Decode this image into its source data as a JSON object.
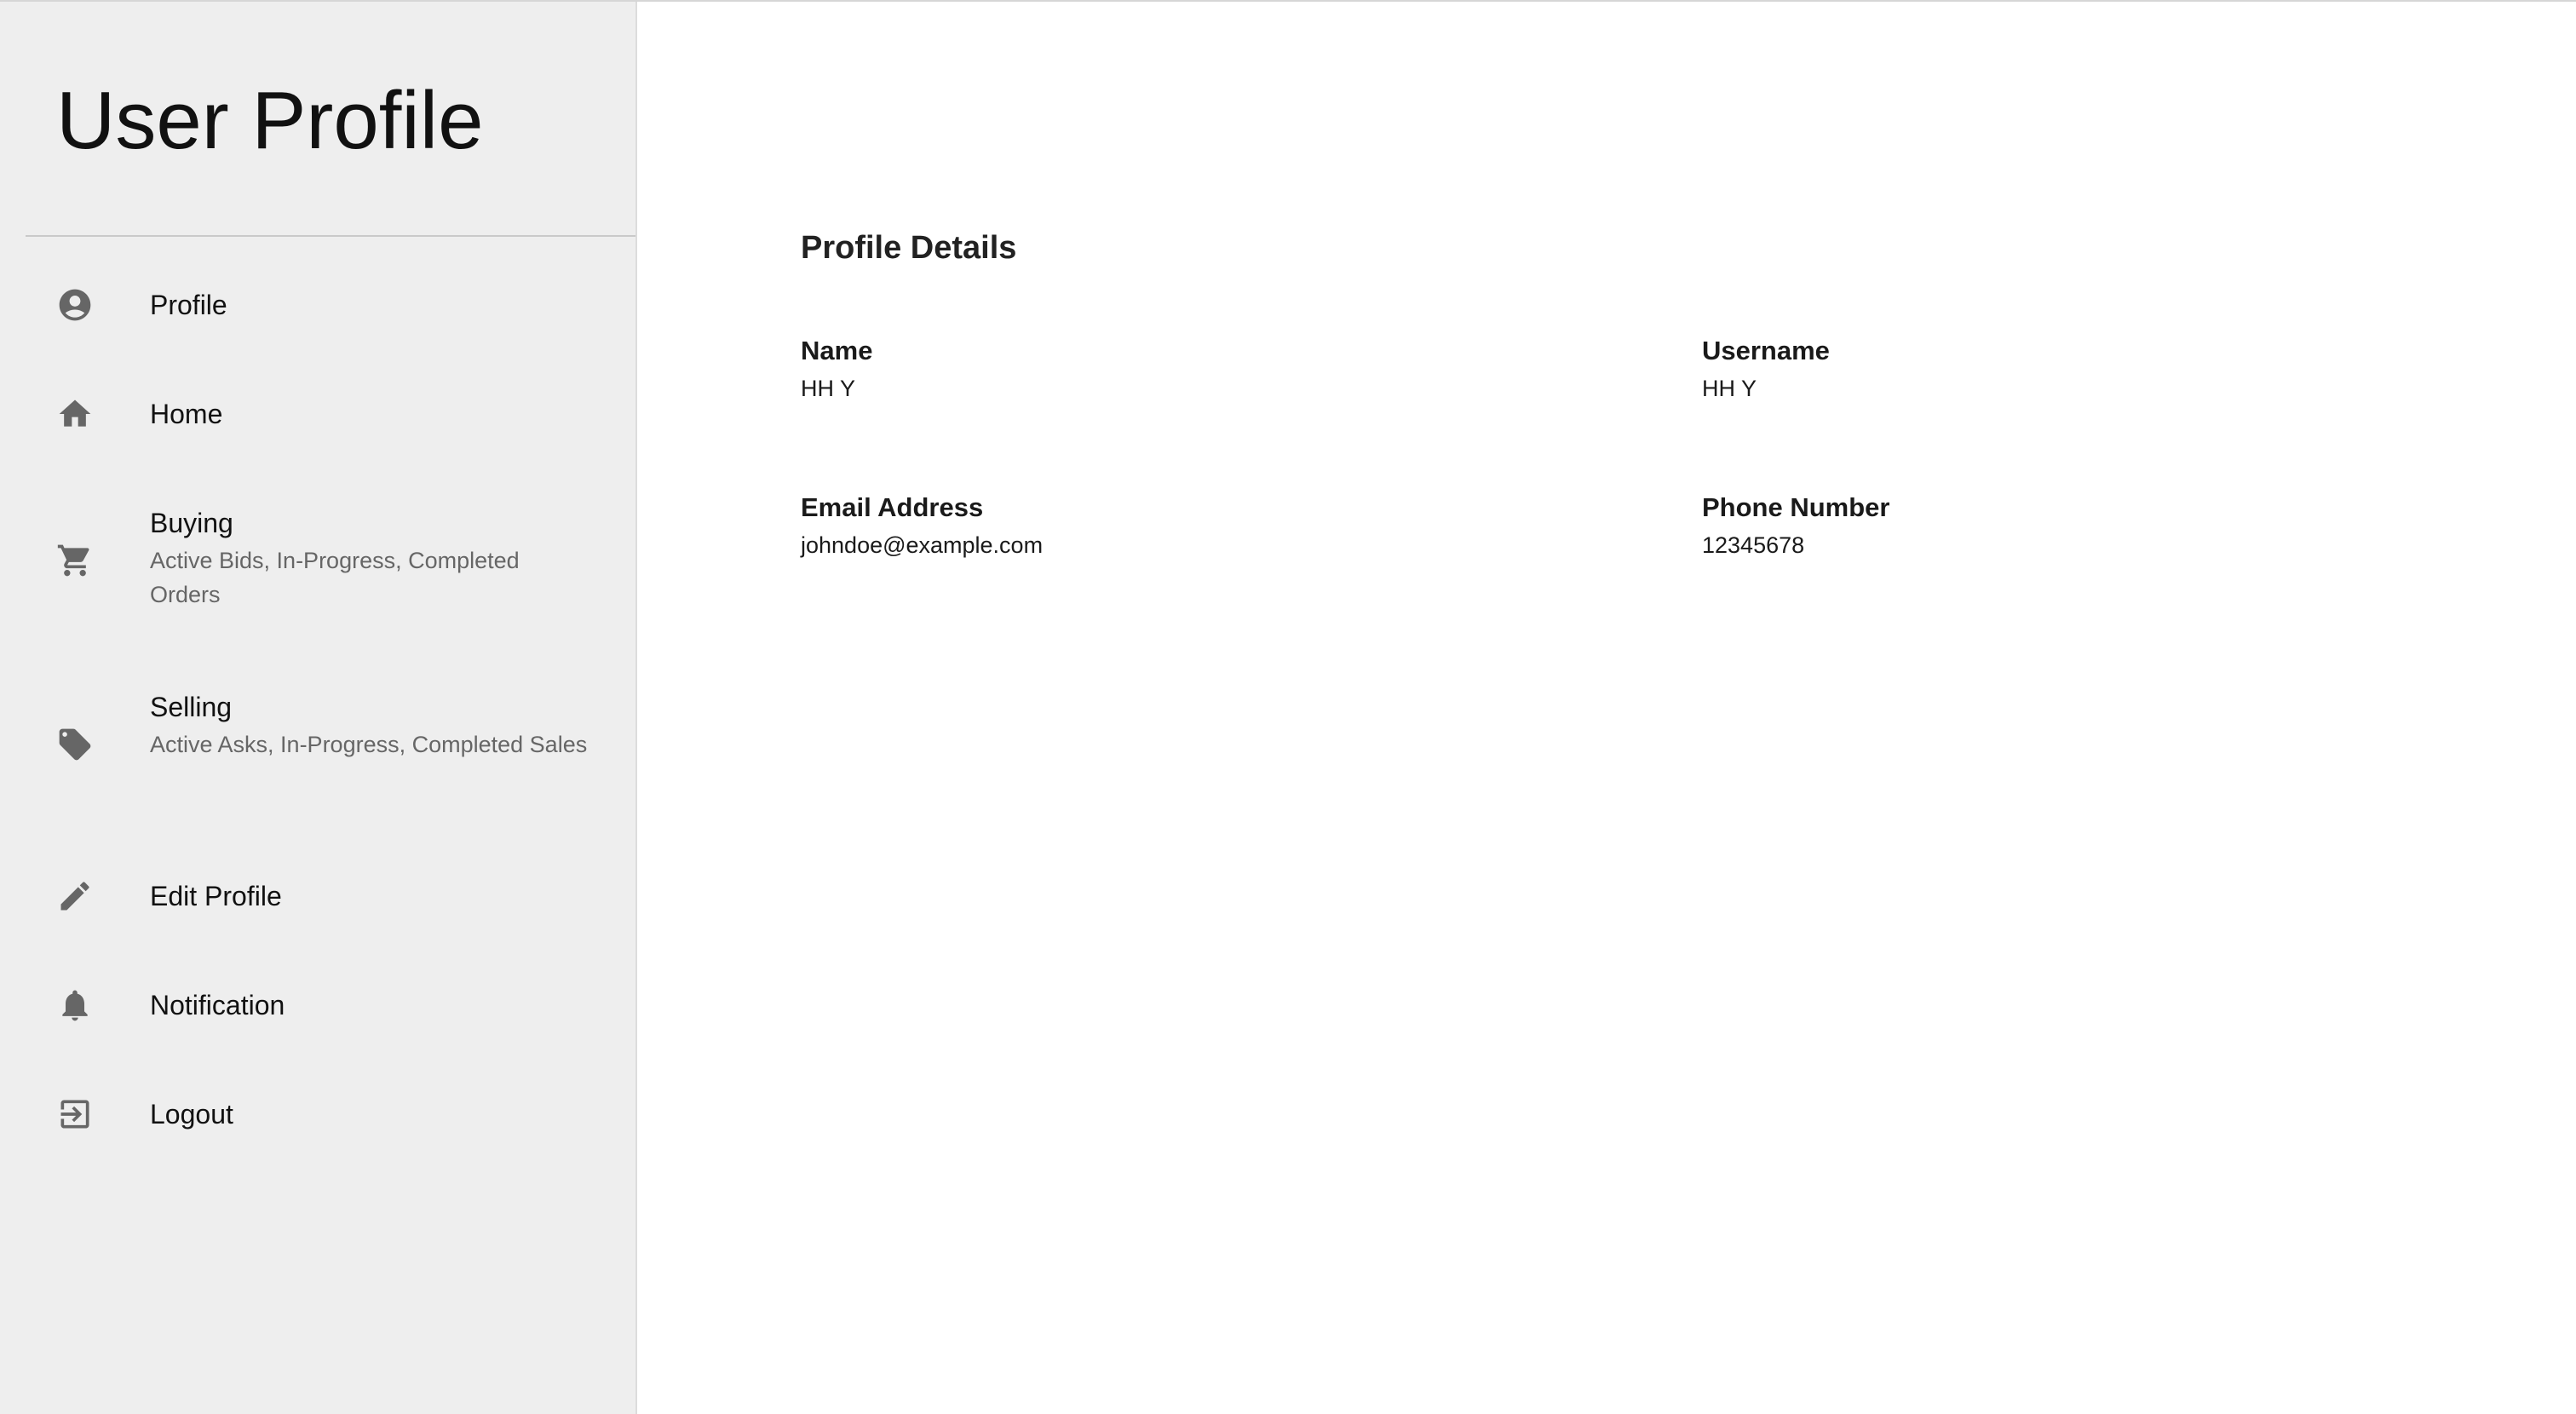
{
  "sidebar": {
    "title": "User Profile",
    "items": [
      {
        "icon": "account-circle-icon",
        "label": "Profile",
        "sub": ""
      },
      {
        "icon": "home-icon",
        "label": "Home",
        "sub": ""
      },
      {
        "icon": "cart-icon",
        "label": "Buying",
        "sub": "Active Bids, In-Progress, Completed Orders"
      },
      {
        "icon": "tag-icon",
        "label": "Selling",
        "sub": "Active Asks, In-Progress, Completed Sales"
      },
      {
        "icon": "pencil-icon",
        "label": "Edit Profile",
        "sub": ""
      },
      {
        "icon": "bell-icon",
        "label": "Notification",
        "sub": ""
      },
      {
        "icon": "logout-icon",
        "label": "Logout",
        "sub": ""
      }
    ],
    "icon_color": "#666666",
    "background": "#eeeeee"
  },
  "main": {
    "heading": "Profile Details",
    "fields": {
      "name": {
        "label": "Name",
        "value": "HH Y"
      },
      "username": {
        "label": "Username",
        "value": "HH Y"
      },
      "email": {
        "label": "Email Address",
        "value": "johndoe@example.com"
      },
      "phone": {
        "label": "Phone Number",
        "value": "12345678"
      }
    }
  }
}
